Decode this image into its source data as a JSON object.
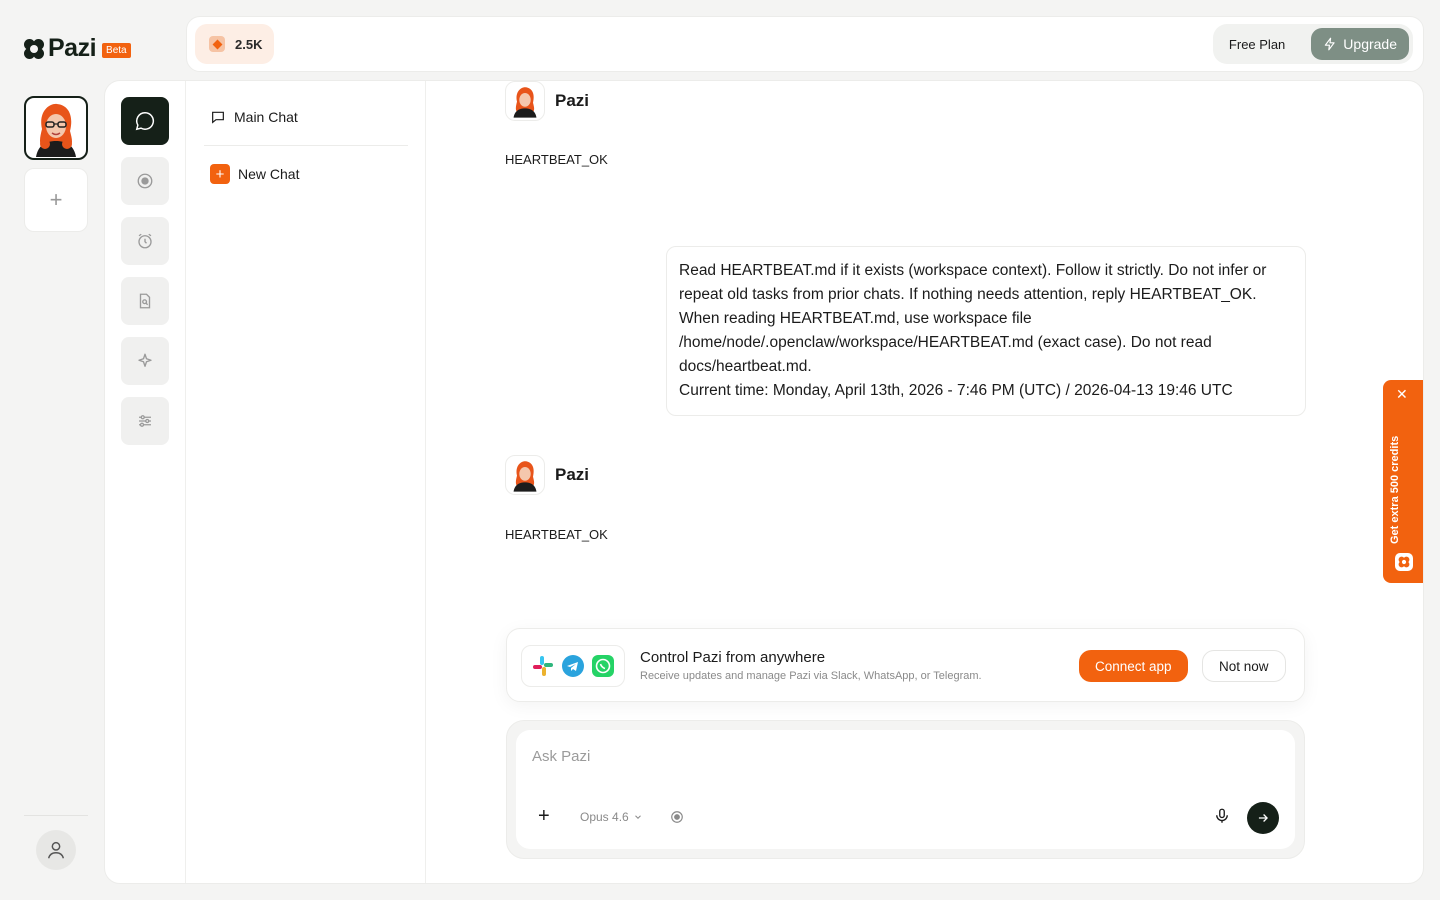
{
  "brand": {
    "name": "Pazi",
    "badge": "Beta",
    "accent": "#f2620f",
    "dark": "#152018"
  },
  "topbar": {
    "credits": "2.5K",
    "plan_label": "Free Plan",
    "upgrade_label": "Upgrade"
  },
  "sidebar": {
    "rail_icons": [
      "chat-bubble-icon",
      "target-icon",
      "alarm-clock-icon",
      "document-search-icon",
      "sparkle-icon",
      "sliders-icon"
    ],
    "chats": [
      {
        "label": "Main Chat",
        "icon": "chat-bubble-icon"
      },
      {
        "label": "New Chat",
        "icon": "plus-icon"
      }
    ]
  },
  "conversation": [
    {
      "sender": "Pazi",
      "text": "HEARTBEAT_OK"
    },
    {
      "sender": "user",
      "text": "Read HEARTBEAT.md if it exists (workspace context). Follow it strictly. Do not infer or repeat old tasks from prior chats. If nothing needs attention, reply HEARTBEAT_OK.\nWhen reading HEARTBEAT.md, use workspace file /home/node/.openclaw/workspace/HEARTBEAT.md (exact case). Do not read docs/heartbeat.md.\nCurrent time: Monday, April 13th, 2026 - 7:46 PM (UTC) / 2026-04-13 19:46 UTC"
    },
    {
      "sender": "Pazi",
      "text": "HEARTBEAT_OK"
    }
  ],
  "connect_card": {
    "title": "Control Pazi from anywhere",
    "subtitle": "Receive updates and manage Pazi via Slack, WhatsApp, or Telegram.",
    "connect_label": "Connect app",
    "dismiss_label": "Not now",
    "apps": [
      "slack-icon",
      "telegram-icon",
      "whatsapp-icon"
    ]
  },
  "composer": {
    "placeholder": "Ask Pazi",
    "value": "",
    "model": "Opus 4.6"
  },
  "promo": {
    "text": "Get extra 500 credits"
  }
}
